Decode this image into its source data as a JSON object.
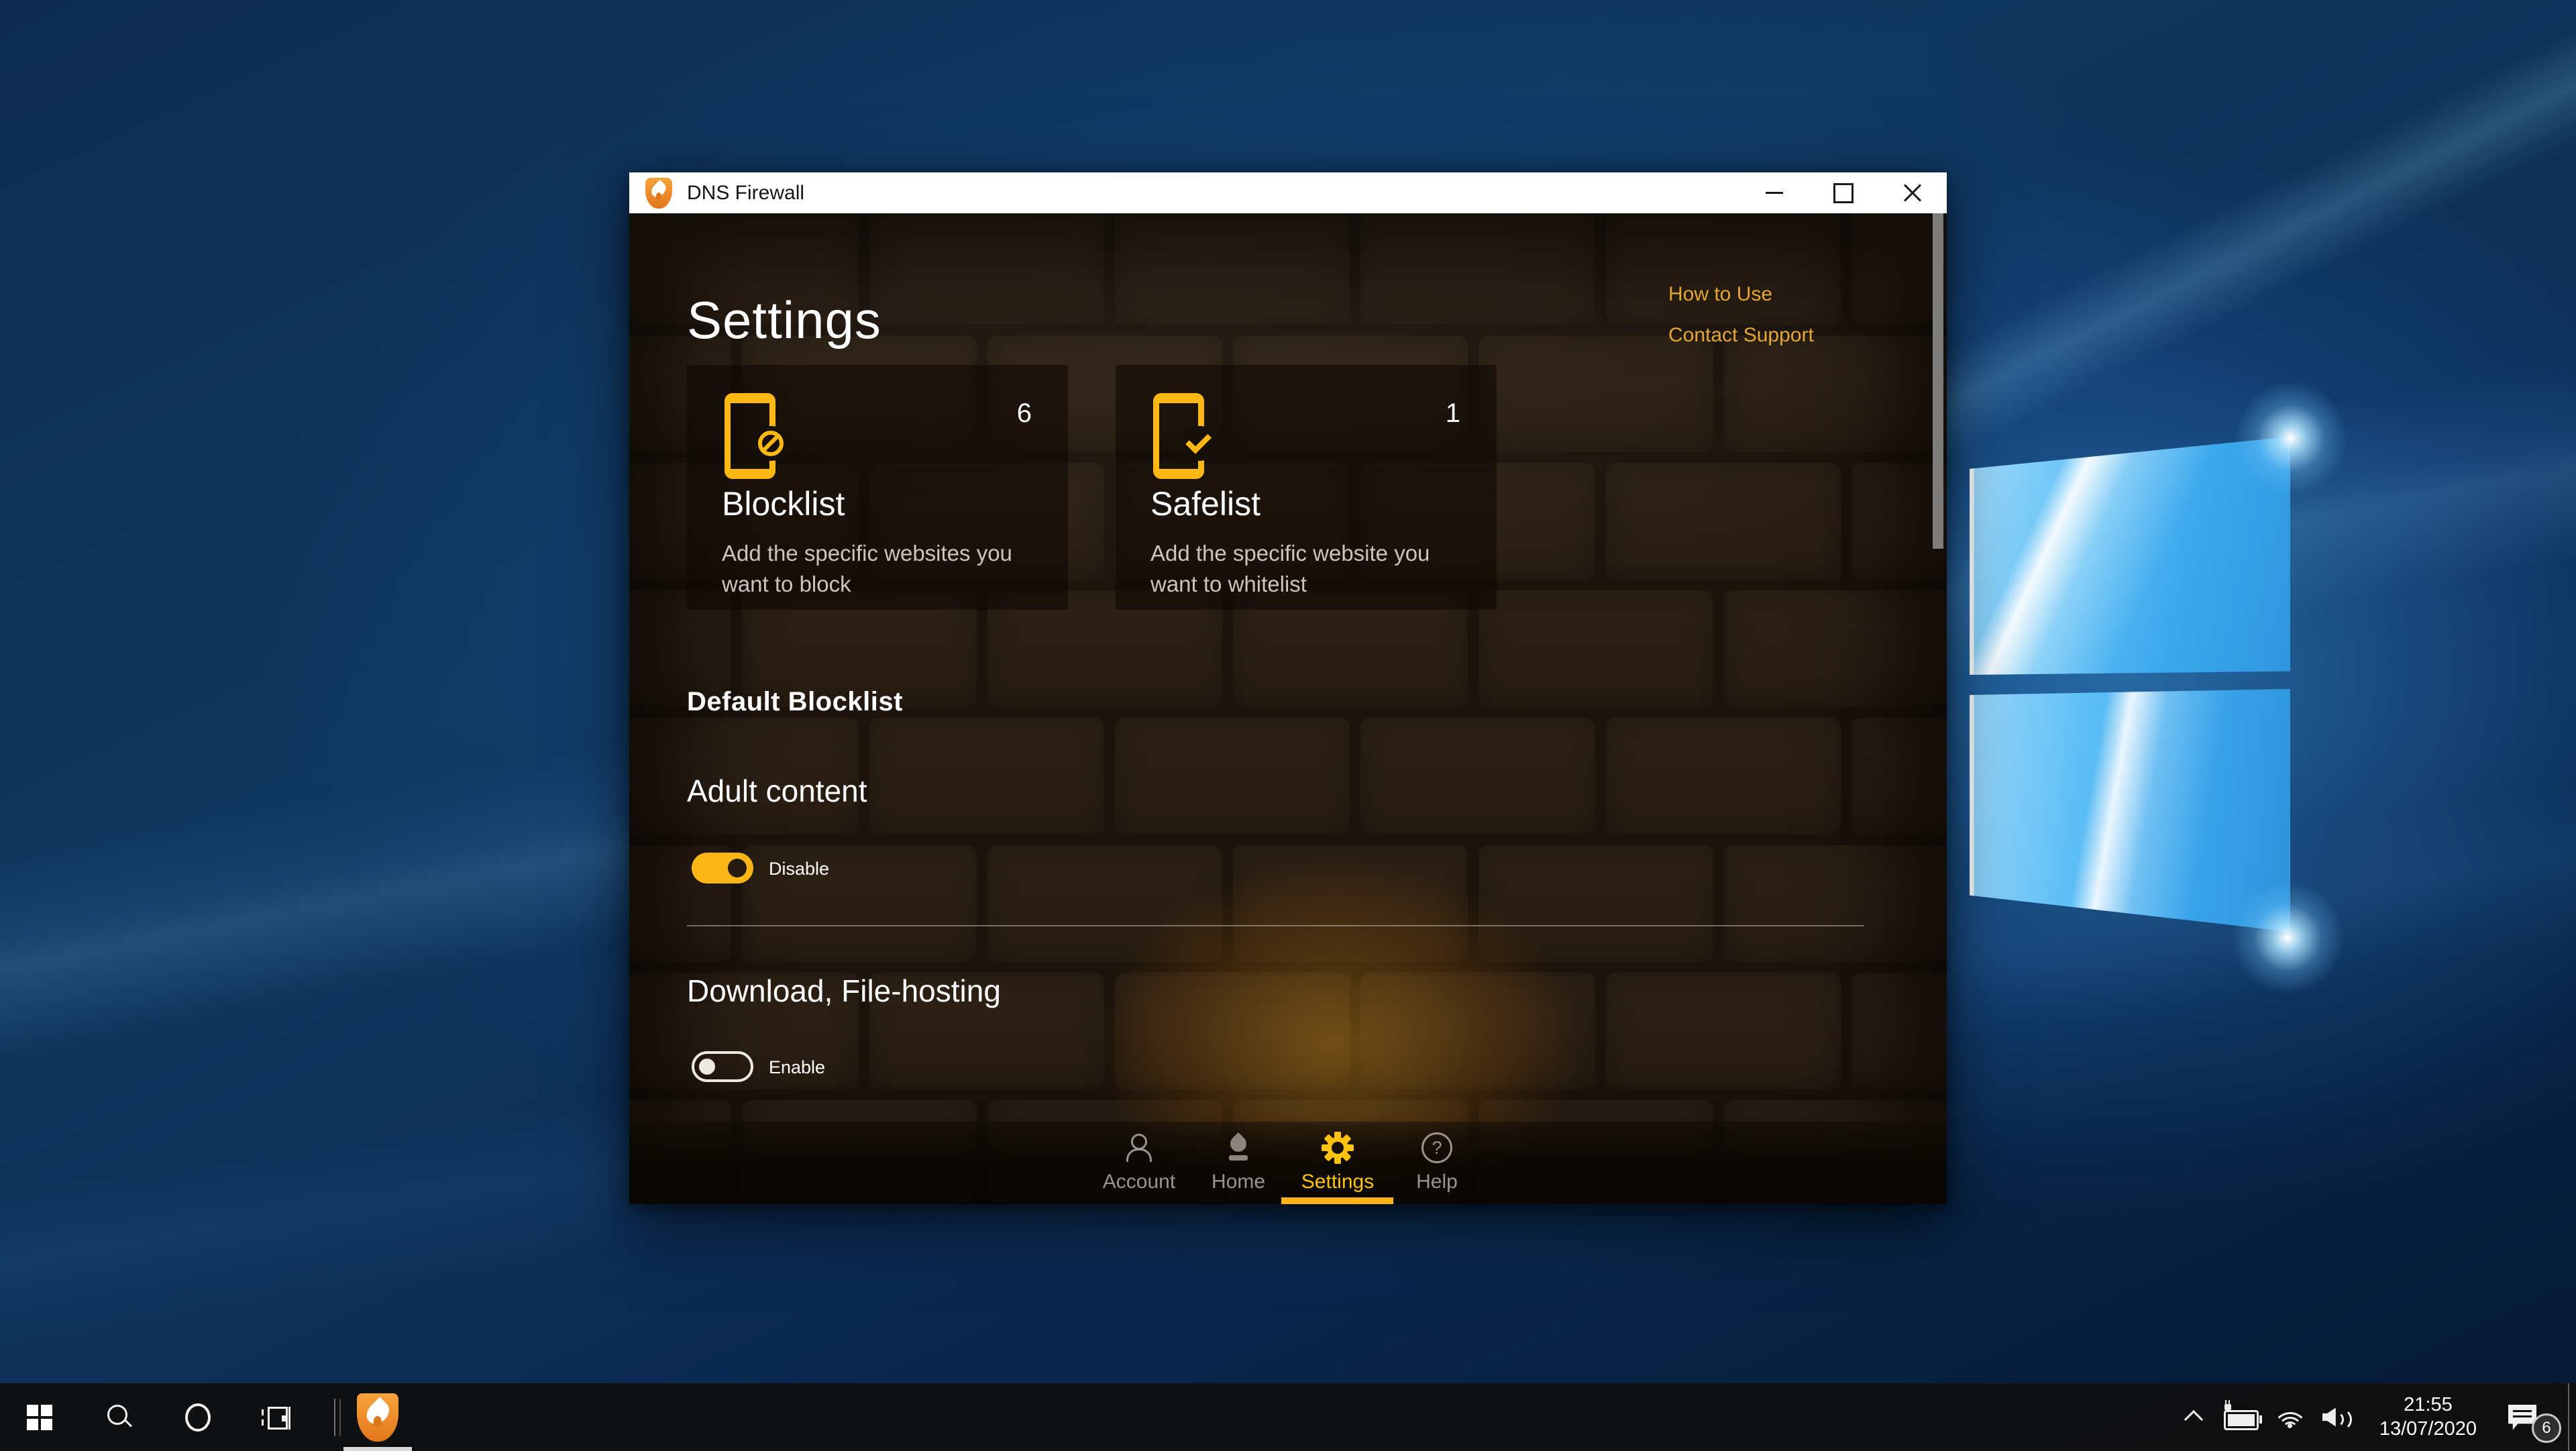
{
  "window": {
    "title": "DNS Firewall"
  },
  "page": {
    "title": "Settings",
    "links": [
      {
        "label": "How to Use"
      },
      {
        "label": "Contact Support"
      }
    ]
  },
  "cards": [
    {
      "count": "6",
      "title": "Blocklist",
      "description": "Add the specific websites you want to block"
    },
    {
      "count": "1",
      "title": "Safelist",
      "description": "Add the specific website you want to whitelist"
    }
  ],
  "settings": {
    "section_heading": "Default Blocklist",
    "items": [
      {
        "label": "Adult content",
        "toggle_label": "Disable",
        "state": "on"
      },
      {
        "label": "Download, File-hosting",
        "toggle_label": "Enable",
        "state": "off"
      }
    ]
  },
  "navbar": {
    "items": [
      {
        "label": "Account"
      },
      {
        "label": "Home"
      },
      {
        "label": "Settings"
      },
      {
        "label": "Help"
      }
    ],
    "active": "Settings"
  },
  "taskbar": {
    "clock": {
      "time": "21:55",
      "date": "13/07/2020"
    },
    "notification_badge": "6"
  },
  "icons": {
    "help_glyph": "?"
  },
  "colors": {
    "accent": "#FBB514",
    "link": "#E2A735",
    "nav_active": "#FFC20E"
  }
}
